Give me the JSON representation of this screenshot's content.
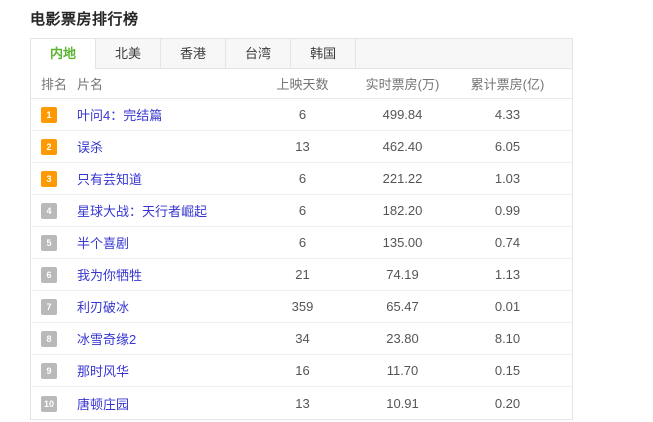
{
  "page": {
    "title": "电影票房排行榜"
  },
  "colors": {
    "active_tab_green": "#5cb531",
    "rank_top3_orange": "#ff9900",
    "rank_gray": "#b9b9b9",
    "link_blue": "#3636d2"
  },
  "tabs": [
    {
      "key": "mainland",
      "label": "内地",
      "active": true
    },
    {
      "key": "north-america",
      "label": "北美",
      "active": false
    },
    {
      "key": "hongkong",
      "label": "香港",
      "active": false
    },
    {
      "key": "taiwan",
      "label": "台湾",
      "active": false
    },
    {
      "key": "korea",
      "label": "韩国",
      "active": false
    }
  ],
  "table": {
    "headers": {
      "rank": "排名",
      "title": "片名",
      "days": "上映天数",
      "realtime": "实时票房(万)",
      "total": "累计票房(亿)"
    },
    "rows": [
      {
        "rank": "1",
        "title": "叶问4：完结篇",
        "days": "6",
        "realtime": "499.84",
        "total": "4.33"
      },
      {
        "rank": "2",
        "title": "误杀",
        "days": "13",
        "realtime": "462.40",
        "total": "6.05"
      },
      {
        "rank": "3",
        "title": "只有芸知道",
        "days": "6",
        "realtime": "221.22",
        "total": "1.03"
      },
      {
        "rank": "4",
        "title": "星球大战：天行者崛起",
        "days": "6",
        "realtime": "182.20",
        "total": "0.99"
      },
      {
        "rank": "5",
        "title": "半个喜剧",
        "days": "6",
        "realtime": "135.00",
        "total": "0.74"
      },
      {
        "rank": "6",
        "title": "我为你牺牲",
        "days": "21",
        "realtime": "74.19",
        "total": "1.13"
      },
      {
        "rank": "7",
        "title": "利刃破冰",
        "days": "359",
        "realtime": "65.47",
        "total": "0.01"
      },
      {
        "rank": "8",
        "title": "冰雪奇缘2",
        "days": "34",
        "realtime": "23.80",
        "total": "8.10"
      },
      {
        "rank": "9",
        "title": "那时风华",
        "days": "16",
        "realtime": "11.70",
        "total": "0.15"
      },
      {
        "rank": "10",
        "title": "唐顿庄园",
        "days": "13",
        "realtime": "10.91",
        "total": "0.20"
      }
    ]
  }
}
